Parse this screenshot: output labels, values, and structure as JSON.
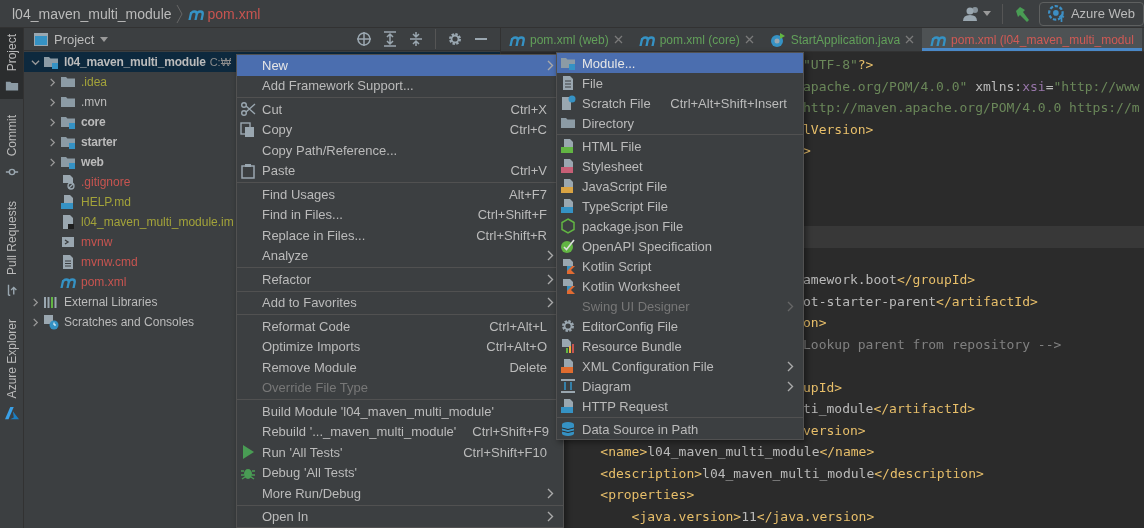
{
  "breadcrumb": {
    "project": "l04_maven_multi_module",
    "file": "pom.xml"
  },
  "toolbar": {
    "run_config": "Azure Web"
  },
  "tool_strip": [
    {
      "label": "Project",
      "selected": true
    },
    {
      "label": "Commit",
      "selected": false
    },
    {
      "label": "Pull Requests",
      "selected": false
    },
    {
      "label": "Azure Explorer",
      "selected": false
    }
  ],
  "project_panel": {
    "title": "Project",
    "tree": [
      {
        "label": "l04_maven_multi_module",
        "path": "C:₩",
        "kind": "module",
        "color": "#bbbbbb",
        "expanded": true,
        "selected": true,
        "children": [
          {
            "label": ".idea",
            "kind": "folder",
            "color": "#a3a33a",
            "expanded": false,
            "selected": false
          },
          {
            "label": ".mvn",
            "kind": "folder",
            "color": "#bbbbbb",
            "expanded": false,
            "selected": false
          },
          {
            "label": "core",
            "kind": "module",
            "color": "#bbbbbb",
            "expanded": false,
            "selected": false
          },
          {
            "label": "starter",
            "kind": "module",
            "color": "#bbbbbb",
            "expanded": false,
            "selected": false
          },
          {
            "label": "web",
            "kind": "module",
            "color": "#bbbbbb",
            "expanded": false,
            "selected": false
          },
          {
            "label": ".gitignore",
            "kind": "ignore_file",
            "color": "#c75450",
            "selected": false
          },
          {
            "label": "HELP.md",
            "kind": "markdown_file",
            "color": "#a3a33a",
            "selected": false
          },
          {
            "label": "l04_maven_multi_module.im",
            "kind": "module_file",
            "color": "#a3a33a",
            "selected": false
          },
          {
            "label": "mvnw",
            "kind": "script",
            "color": "#c75450",
            "selected": false
          },
          {
            "label": "mvnw.cmd",
            "kind": "text_file",
            "color": "#c75450",
            "selected": false
          },
          {
            "label": "pom.xml",
            "kind": "build_file",
            "color": "#c75450",
            "selected": false
          }
        ]
      },
      {
        "label": "External Libraries",
        "kind": "libraries",
        "color": "#bbbbbb",
        "expanded": false,
        "selected": false
      },
      {
        "label": "Scratches and Consoles",
        "kind": "scratches",
        "color": "#bbbbbb",
        "expanded": false,
        "selected": false
      }
    ]
  },
  "editor": {
    "tabs": [
      {
        "label": "pom.xml (web)",
        "kind": "build_file",
        "color": "#62a05a",
        "selected": false
      },
      {
        "label": "pom.xml (core)",
        "kind": "build_file",
        "color": "#62a05a",
        "selected": false
      },
      {
        "label": "StartApplication.java",
        "kind": "java_class",
        "color": "#62a05a",
        "selected": false
      },
      {
        "label": "pom.xml (l04_maven_multi_modul",
        "kind": "build_file",
        "color": "#d05a55",
        "selected": true
      }
    ],
    "lines": [
      {
        "kind": "clipped",
        "current": false,
        "tokens": [
          {
            "kind": "string",
            "text": "\"UTF-8\""
          },
          {
            "kind": "tag",
            "text": "?>"
          }
        ]
      },
      {
        "kind": "clipped",
        "current": false,
        "tokens": [
          {
            "kind": "string",
            "text": "apache.org/POM/4.0.0\""
          },
          {
            "kind": "plain",
            "text": " xmlns:"
          },
          {
            "kind": "ns",
            "text": "xsi"
          },
          {
            "kind": "plain",
            "text": "="
          },
          {
            "kind": "string",
            "text": "\"http://www"
          }
        ]
      },
      {
        "kind": "clipped",
        "current": false,
        "tokens": [
          {
            "kind": "string",
            "text": "http://maven.apache.org/POM/4.0.0 https://m"
          }
        ]
      },
      {
        "kind": "clipped",
        "current": false,
        "tokens": [
          {
            "kind": "tag",
            "text": "lVersion>"
          }
        ]
      },
      {
        "kind": "clipped",
        "current": false,
        "tokens": [
          {
            "kind": "tag",
            "text": ">"
          }
        ]
      },
      {
        "kind": "empty",
        "current": false
      },
      {
        "kind": "empty",
        "current": false
      },
      {
        "kind": "empty",
        "current": false
      },
      {
        "kind": "empty",
        "current": true
      },
      {
        "kind": "empty",
        "current": false
      },
      {
        "kind": "clipped",
        "current": false,
        "tokens": [
          {
            "kind": "plain",
            "text": "amework.boot"
          },
          {
            "kind": "tag",
            "text": "</groupId>"
          }
        ]
      },
      {
        "kind": "clipped",
        "current": false,
        "tokens": [
          {
            "kind": "plain",
            "text": "ot-starter-parent"
          },
          {
            "kind": "tag",
            "text": "</artifactId>"
          }
        ]
      },
      {
        "kind": "clipped",
        "current": false,
        "tokens": [
          {
            "kind": "tag",
            "text": "on>"
          }
        ]
      },
      {
        "kind": "clipped",
        "current": false,
        "tokens": [
          {
            "kind": "comment",
            "text": "Lookup parent from repository -->"
          }
        ]
      },
      {
        "kind": "empty",
        "current": false
      },
      {
        "kind": "clipped",
        "current": false,
        "tokens": [
          {
            "kind": "tag",
            "text": "upId>"
          }
        ]
      },
      {
        "kind": "clipped",
        "current": false,
        "tokens": [
          {
            "kind": "plain",
            "text": "ti_module"
          },
          {
            "kind": "tag",
            "text": "</artifactId>"
          }
        ]
      },
      {
        "kind": "clipped",
        "current": false,
        "tokens": [
          {
            "kind": "tag",
            "text": "version>"
          }
        ]
      },
      {
        "kind": "full",
        "current": false,
        "tokens": [
          {
            "kind": "tag",
            "text": "    <name>"
          },
          {
            "kind": "plain",
            "text": "l04_maven_multi_module"
          },
          {
            "kind": "tag",
            "text": "</name>"
          }
        ]
      },
      {
        "kind": "full",
        "current": false,
        "tokens": [
          {
            "kind": "tag",
            "text": "    <description>"
          },
          {
            "kind": "plain",
            "text": "l04_maven_multi_module"
          },
          {
            "kind": "tag",
            "text": "</description>"
          }
        ]
      },
      {
        "kind": "full",
        "current": false,
        "tokens": [
          {
            "kind": "tag",
            "text": "    <properties>"
          }
        ]
      },
      {
        "kind": "full",
        "current": false,
        "tokens": [
          {
            "kind": "tag",
            "text": "        <java.version>"
          },
          {
            "kind": "plain",
            "text": "11"
          },
          {
            "kind": "tag",
            "text": "</java.version>"
          }
        ]
      }
    ]
  },
  "context_menu": {
    "groups": [
      [
        {
          "label": "New",
          "selected": true,
          "disabled": false,
          "submenu": true
        },
        {
          "label": "Add Framework Support...",
          "selected": false,
          "disabled": false,
          "submenu": false
        }
      ],
      [
        {
          "label": "Cut",
          "shortcut": "Ctrl+X",
          "kind": "cut",
          "selected": false,
          "disabled": false,
          "submenu": false
        },
        {
          "label": "Copy",
          "shortcut": "Ctrl+C",
          "kind": "copy",
          "selected": false,
          "disabled": false,
          "submenu": false
        },
        {
          "label": "Copy Path/Reference...",
          "selected": false,
          "disabled": false,
          "submenu": false
        },
        {
          "label": "Paste",
          "shortcut": "Ctrl+V",
          "kind": "paste",
          "selected": false,
          "disabled": false,
          "submenu": false
        }
      ],
      [
        {
          "label": "Find Usages",
          "shortcut": "Alt+F7",
          "selected": false,
          "disabled": false,
          "submenu": false
        },
        {
          "label": "Find in Files...",
          "shortcut": "Ctrl+Shift+F",
          "selected": false,
          "disabled": false,
          "submenu": false
        },
        {
          "label": "Replace in Files...",
          "shortcut": "Ctrl+Shift+R",
          "selected": false,
          "disabled": false,
          "submenu": false
        },
        {
          "label": "Analyze",
          "selected": false,
          "disabled": false,
          "submenu": true
        }
      ],
      [
        {
          "label": "Refactor",
          "selected": false,
          "disabled": false,
          "submenu": true
        }
      ],
      [
        {
          "label": "Add to Favorites",
          "selected": false,
          "disabled": false,
          "submenu": true
        }
      ],
      [
        {
          "label": "Reformat Code",
          "shortcut": "Ctrl+Alt+L",
          "selected": false,
          "disabled": false,
          "submenu": false
        },
        {
          "label": "Optimize Imports",
          "shortcut": "Ctrl+Alt+O",
          "selected": false,
          "disabled": false,
          "submenu": false
        },
        {
          "label": "Remove Module",
          "shortcut": "Delete",
          "selected": false,
          "disabled": false,
          "submenu": false
        },
        {
          "label": "Override File Type",
          "selected": false,
          "disabled": true,
          "submenu": false
        }
      ],
      [
        {
          "label": "Build Module 'l04_maven_multi_module'",
          "selected": false,
          "disabled": false,
          "submenu": false
        },
        {
          "label": "Rebuild '..._maven_multi_module'",
          "shortcut": "Ctrl+Shift+F9",
          "selected": false,
          "disabled": false,
          "submenu": false
        },
        {
          "label": "Run 'All Tests'",
          "shortcut": "Ctrl+Shift+F10",
          "kind": "run",
          "selected": false,
          "disabled": false,
          "submenu": false
        },
        {
          "label": "Debug 'All Tests'",
          "kind": "debug",
          "selected": false,
          "disabled": false,
          "submenu": false
        },
        {
          "label": "More Run/Debug",
          "selected": false,
          "disabled": false,
          "submenu": true
        }
      ],
      [
        {
          "label": "Open In",
          "selected": false,
          "disabled": false,
          "submenu": true
        }
      ]
    ]
  },
  "submenu": {
    "groups": [
      [
        {
          "label": "Module...",
          "kind": "module",
          "selected": true,
          "disabled": false,
          "submenu": false
        },
        {
          "label": "File",
          "kind": "file",
          "selected": false,
          "disabled": false,
          "submenu": false
        },
        {
          "label": "Scratch File",
          "shortcut": "Ctrl+Alt+Shift+Insert",
          "kind": "scratch",
          "selected": false,
          "disabled": false,
          "submenu": false
        },
        {
          "label": "Directory",
          "kind": "folder",
          "selected": false,
          "disabled": false,
          "submenu": false
        }
      ],
      [
        {
          "label": "HTML File",
          "kind": "html",
          "selected": false,
          "disabled": false,
          "submenu": false
        },
        {
          "label": "Stylesheet",
          "kind": "css",
          "selected": false,
          "disabled": false,
          "submenu": false
        },
        {
          "label": "JavaScript File",
          "kind": "js",
          "selected": false,
          "disabled": false,
          "submenu": false
        },
        {
          "label": "TypeScript File",
          "kind": "ts",
          "selected": false,
          "disabled": false,
          "submenu": false
        },
        {
          "label": "package.json File",
          "kind": "package",
          "selected": false,
          "disabled": false,
          "submenu": false
        },
        {
          "label": "OpenAPI Specification",
          "kind": "openapi",
          "selected": false,
          "disabled": false,
          "submenu": false
        },
        {
          "label": "Kotlin Script",
          "kind": "kotlin",
          "selected": false,
          "disabled": false,
          "submenu": false
        },
        {
          "label": "Kotlin Worksheet",
          "kind": "kotlin",
          "selected": false,
          "disabled": false,
          "submenu": false
        },
        {
          "label": "Swing UI Designer",
          "selected": false,
          "disabled": true,
          "submenu": true
        },
        {
          "label": "EditorConfig File",
          "kind": "editorconfig",
          "selected": false,
          "disabled": false,
          "submenu": false
        },
        {
          "label": "Resource Bundle",
          "kind": "resource",
          "selected": false,
          "disabled": false,
          "submenu": false
        },
        {
          "label": "XML Configuration File",
          "kind": "xml",
          "selected": false,
          "disabled": false,
          "submenu": true
        },
        {
          "label": "Diagram",
          "kind": "diagram",
          "selected": false,
          "disabled": false,
          "submenu": true
        },
        {
          "label": "HTTP Request",
          "kind": "http",
          "selected": false,
          "disabled": false,
          "submenu": false
        }
      ],
      [
        {
          "label": "Data Source in Path",
          "kind": "datasource",
          "selected": false,
          "disabled": false,
          "submenu": false
        }
      ]
    ]
  }
}
